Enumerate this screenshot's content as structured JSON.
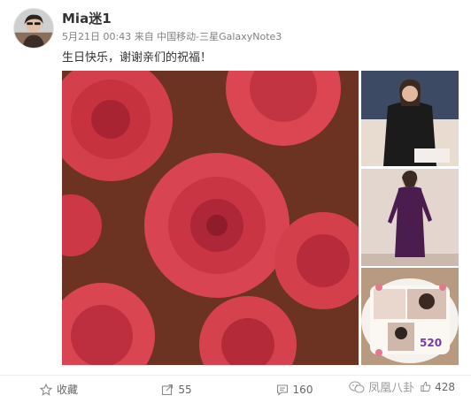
{
  "post": {
    "username": "Mia迷1",
    "meta": "5月21日 00:43 来自 中国移动-三星GalaxyNote3",
    "text": "生日快乐，谢谢亲们的祝福！"
  },
  "photos": {
    "cake_texts": [
      "520"
    ]
  },
  "actions": {
    "favorite_label": "收藏",
    "repost_count": "55",
    "comment_count": "160",
    "like_count": "428"
  },
  "watermark": {
    "text": "凤凰八卦"
  },
  "icons": {
    "favorite": "star-icon",
    "repost": "share-icon",
    "comment": "comment-icon",
    "like": "thumbs-up-icon",
    "watermark": "wechat-icon"
  },
  "colors": {
    "rose": "#d8404e",
    "rose_dark": "#9c1f2e",
    "text_meta": "#808080",
    "divider": "#eeeeee"
  }
}
